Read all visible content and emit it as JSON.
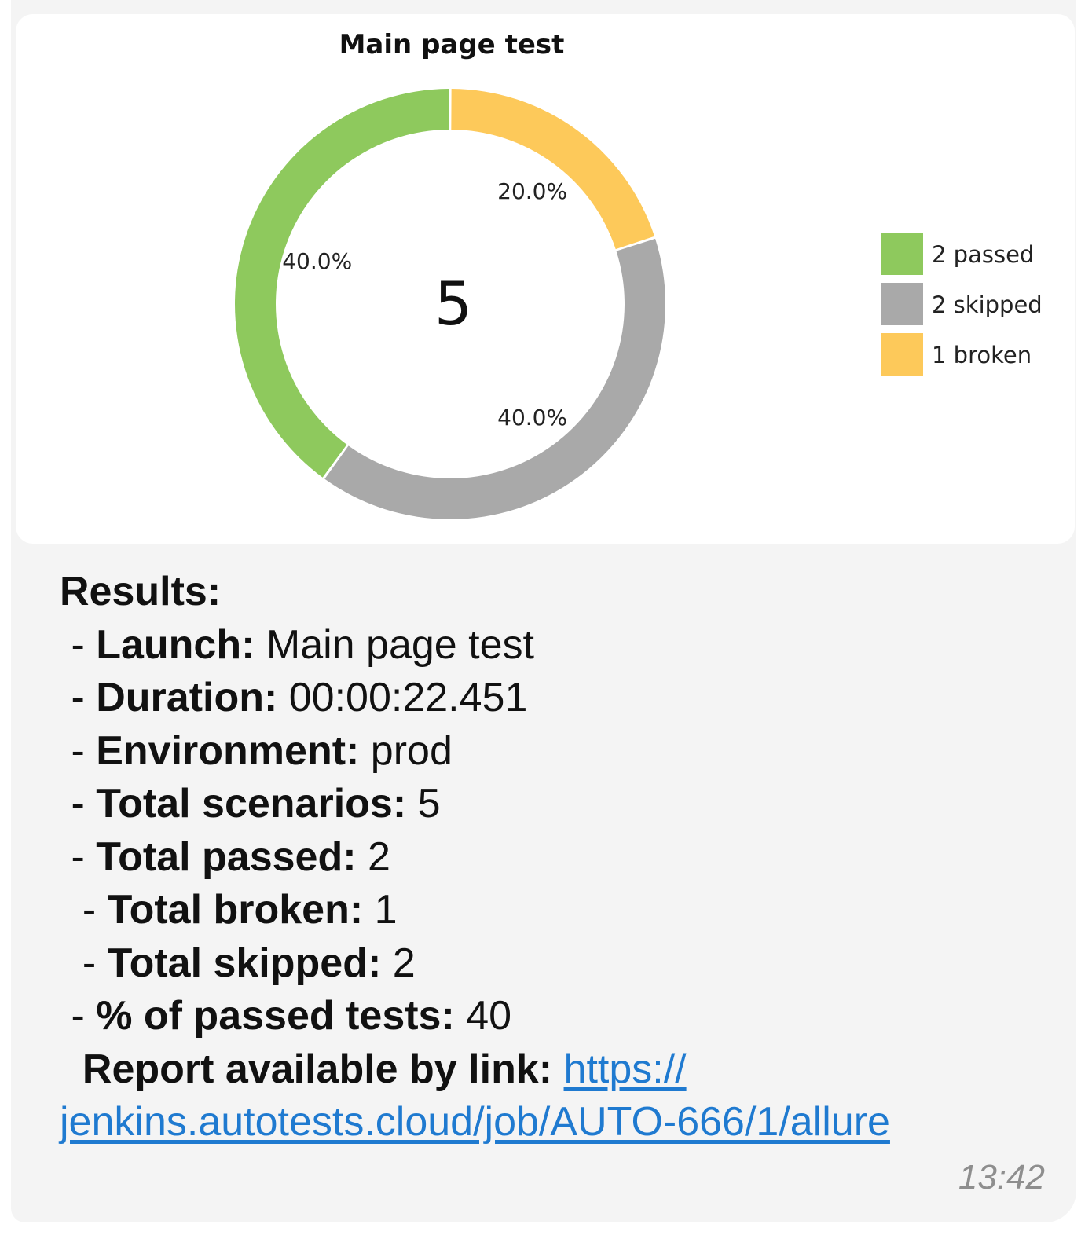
{
  "chart_data": {
    "type": "pie",
    "variant": "donut",
    "title": "Main page test",
    "center_label": "5",
    "slices": [
      {
        "label": "2 passed",
        "value": 2,
        "percent_label": "40.0%",
        "color": "#8ec95d"
      },
      {
        "label": "2 skipped",
        "value": 2,
        "percent_label": "40.0%",
        "color": "#a9a9a9"
      },
      {
        "label": "1 broken",
        "value": 1,
        "percent_label": "20.0%",
        "color": "#fdc95a"
      }
    ],
    "start_slice": "broken",
    "legend_placement": "right"
  },
  "results": {
    "heading": "Results:",
    "items": [
      {
        "prefix": " - ",
        "key": "Launch:",
        "value": " Main page test"
      },
      {
        "prefix": " - ",
        "key": "Duration:",
        "value": " 00:00:22.451"
      },
      {
        "prefix": " - ",
        "key": "Environment:",
        "value": " prod"
      },
      {
        "prefix": " - ",
        "key": "Total scenarios:",
        "value": " 5"
      },
      {
        "prefix": " - ",
        "key": "Total passed:",
        "value": " 2"
      },
      {
        "prefix": "  - ",
        "key": "Total broken:",
        "value": " 1"
      },
      {
        "prefix": "  - ",
        "key": "Total skipped:",
        "value": " 2"
      },
      {
        "prefix": " - ",
        "key": "% of passed tests:",
        "value": " 40"
      }
    ],
    "report_label": "  Report available by link: ",
    "link_part1": "https://",
    "link_part2": "jenkins.autotests.cloud/job/AUTO-666/1/allure"
  },
  "message": {
    "time": "13:42",
    "colors": {
      "bubble": "#f4f4f4",
      "link": "#1f7ad0"
    }
  }
}
